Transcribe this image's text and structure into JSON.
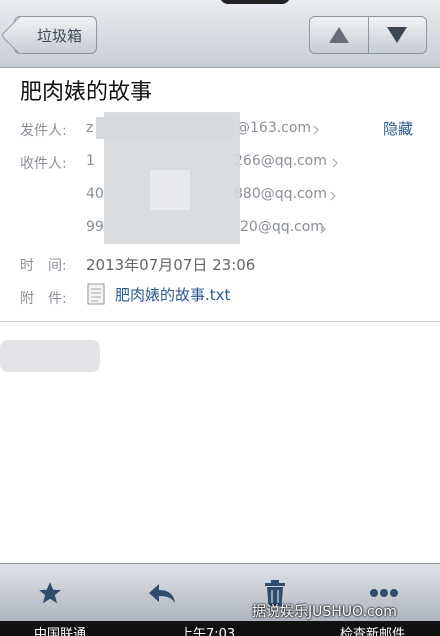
{
  "nav": {
    "back_label": "垃圾箱"
  },
  "email": {
    "subject": "肥肉婊的故事",
    "from_label": "发件人:",
    "from_visible": [
      "z",
      "@163.com"
    ],
    "hide_label": "隐藏",
    "to_label": "收件人:",
    "to_rows": [
      {
        "prefix": "1",
        "suffix": "266@qq.com"
      },
      {
        "prefix": "40",
        "suffix": "880@qq.com"
      },
      {
        "prefix": "99",
        "suffix": "20@qq.com"
      }
    ],
    "time_label": "时　间:",
    "time_value": "2013年07月07日 23:06",
    "attach_label": "附　件:",
    "attachment_name": "肥肉婊的故事.txt"
  },
  "watermark": "据说娱乐JUSHUO.com",
  "status": {
    "carrier": "中国联通",
    "time": "上午7:03",
    "right": "检查新邮件"
  },
  "icons": [
    "triangle-up-icon",
    "triangle-down-icon",
    "star-icon",
    "reply-icon",
    "trash-icon",
    "more-icon",
    "document-icon",
    "chevron-right-icon"
  ]
}
